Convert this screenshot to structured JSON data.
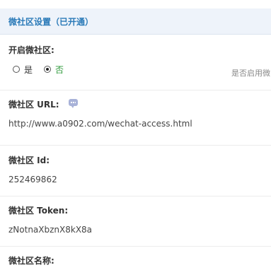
{
  "header": {
    "title": "微社区设置（已开通）"
  },
  "enable": {
    "label": "开启微社区:",
    "options": [
      {
        "label": "是",
        "selected": false
      },
      {
        "label": "否",
        "selected": true
      }
    ],
    "hint": "是否启用微"
  },
  "url": {
    "label": "微社区 URL:",
    "value": "http://www.a0902.com/wechat-access.html",
    "help_icon": "speech-bubble-icon"
  },
  "id": {
    "label": "微社区 Id:",
    "value": "252469862"
  },
  "token": {
    "label": "微社区 Token:",
    "value": "zNotnaXbznX8kX8a"
  },
  "name": {
    "label": "微社区名称:"
  }
}
